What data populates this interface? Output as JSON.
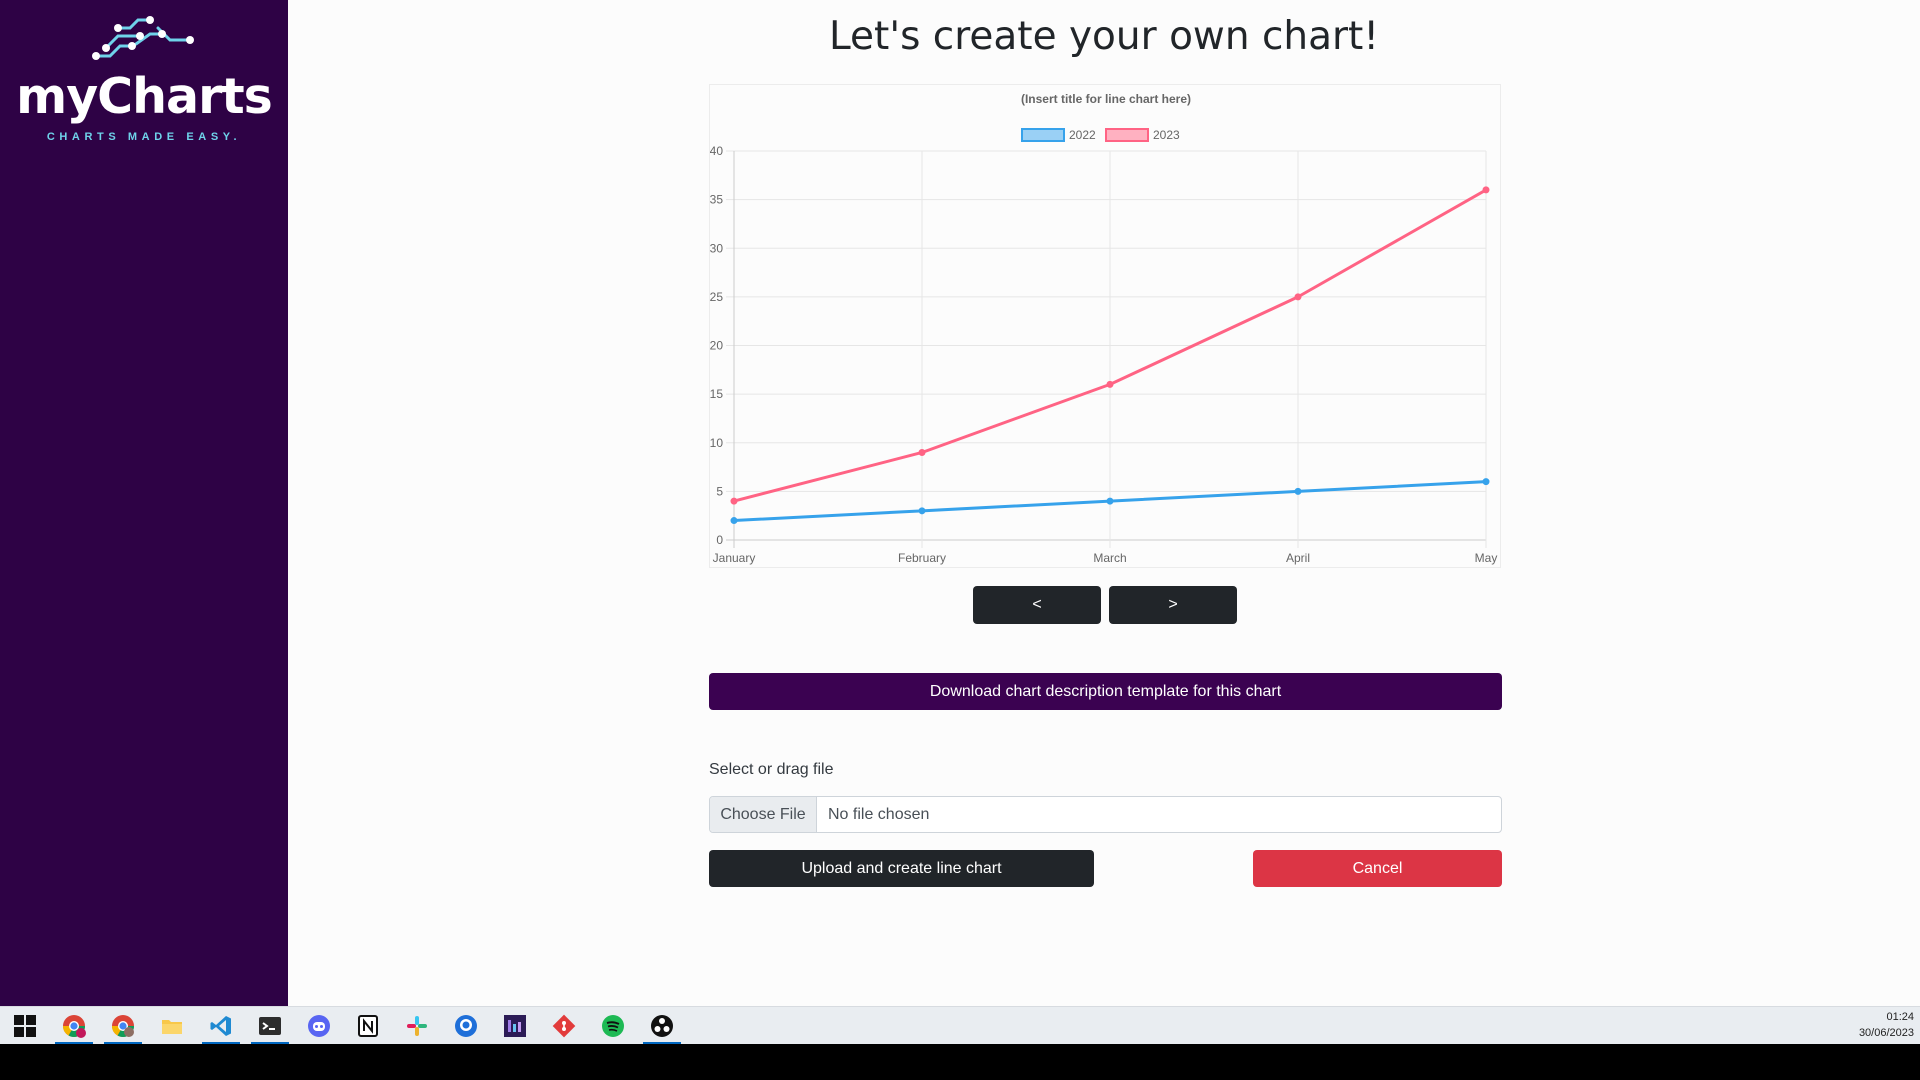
{
  "brand": {
    "name": "myCharts",
    "tagline": "CHARTS MADE EASY."
  },
  "page": {
    "title": "Let's create your own chart!"
  },
  "chart_data": {
    "type": "line",
    "title": "(Insert title for line chart here)",
    "categories": [
      "January",
      "February",
      "March",
      "April",
      "May"
    ],
    "series": [
      {
        "name": "2022",
        "values": [
          2,
          3,
          4,
          5,
          6
        ],
        "color": "#36a2eb",
        "fill": "#9ad0f5"
      },
      {
        "name": "2023",
        "values": [
          4,
          9,
          16,
          25,
          36
        ],
        "color": "#ff6384",
        "fill": "#ffb1c1"
      }
    ],
    "ylim": [
      0,
      40
    ],
    "yticks": [
      0,
      5,
      10,
      15,
      20,
      25,
      30,
      35,
      40
    ],
    "grid": true,
    "legend_position": "top"
  },
  "nav": {
    "prev_label": "<",
    "next_label": ">"
  },
  "actions": {
    "download_label": "Download chart description template for this chart",
    "file_label": "Select or drag file",
    "choose_file_label": "Choose File",
    "file_status": "No file chosen",
    "upload_label": "Upload and create line chart",
    "cancel_label": "Cancel"
  },
  "taskbar": {
    "apps": [
      {
        "icon": "windows-start-icon"
      },
      {
        "icon": "chrome-icon"
      },
      {
        "icon": "chrome-profile-icon"
      },
      {
        "icon": "file-explorer-icon"
      },
      {
        "icon": "vscode-icon"
      },
      {
        "icon": "terminal-icon"
      },
      {
        "icon": "discord-icon"
      },
      {
        "icon": "notion-icon"
      },
      {
        "icon": "slack-icon"
      },
      {
        "icon": "github-desktop-icon"
      },
      {
        "icon": "visual-studio-icon"
      },
      {
        "icon": "git-icon"
      },
      {
        "icon": "spotify-icon"
      },
      {
        "icon": "obs-icon"
      }
    ],
    "time": "01:24",
    "date": "30/06/2023"
  },
  "colors": {
    "sidebar": "#2e0245",
    "download_button": "#3b0251",
    "dark_button": "#212529",
    "cancel_button": "#dc3545",
    "logo_accent": "#6fd3ea"
  }
}
